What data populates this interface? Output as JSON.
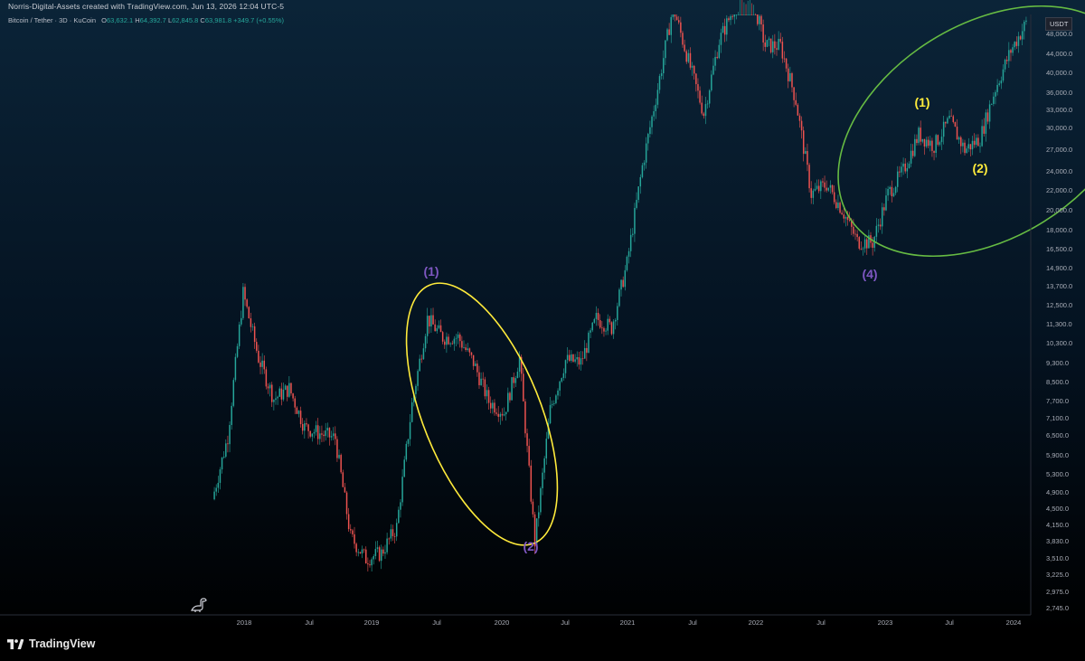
{
  "header": {
    "attribution": "Norris-Digital-Assets created with TradingView.com, Jun 13, 2026 12:04 UTC-5"
  },
  "legend": {
    "symbol": "Bitcoin / Tether · 3D · KuCoin",
    "open_label": "O",
    "open": "63,632.1",
    "high_label": "H",
    "high": "64,392.7",
    "low_label": "L",
    "low": "62,845.8",
    "close_label": "C",
    "close": "63,981.8",
    "change": "+349.7 (+0.55%)"
  },
  "price_axis": {
    "currency_badge": "USDT",
    "ticks": [
      "48,000.0",
      "44,000.0",
      "40,000.0",
      "36,000.0",
      "33,000.0",
      "30,000.0",
      "27,000.0",
      "24,000.0",
      "22,000.0",
      "20,000.0",
      "18,000.0",
      "16,500.0",
      "14,900.0",
      "13,700.0",
      "12,500.0",
      "11,300.0",
      "10,300.0",
      "9,300.0",
      "8,500.0",
      "7,700.0",
      "7,100.0",
      "6,500.0",
      "5,900.0",
      "5,300.0",
      "4,900.0",
      "4,500.0",
      "4,150.0",
      "3,830.0",
      "3,510.0",
      "3,225.0",
      "2,975.0",
      "2,745.0"
    ]
  },
  "time_axis": {
    "ticks": [
      "2018",
      "Jul",
      "2019",
      "Jul",
      "2020",
      "Jul",
      "2021",
      "Jul",
      "2022",
      "Jul",
      "2023",
      "Jul",
      "2024"
    ]
  },
  "annotations": {
    "wave_labels": [
      {
        "text": "(1)",
        "color": "#7e57c2"
      },
      {
        "text": "(2)",
        "color": "#7e57c2"
      },
      {
        "text": "(4)",
        "color": "#7e57c2"
      },
      {
        "text": "(1)",
        "color": "#ffeb3b"
      },
      {
        "text": "(2)",
        "color": "#ffeb3b"
      }
    ],
    "ellipse_colors": {
      "yellow": "#ffeb3b",
      "green": "#66bb43"
    }
  },
  "colors": {
    "up": "#26a69a",
    "down": "#ef5350",
    "bg_top": "#0b2438",
    "bg_bottom": "#000000"
  },
  "chart_data": {
    "type": "candlestick",
    "scale": "log",
    "ylim": [
      2745,
      50000
    ],
    "x": [
      "2017-10",
      "2017-12",
      "2018-01",
      "2018-02",
      "2018-04",
      "2018-05",
      "2018-07",
      "2018-08",
      "2018-10",
      "2018-11",
      "2018-12",
      "2019-02",
      "2019-04",
      "2019-05",
      "2019-06",
      "2019-07",
      "2019-08",
      "2019-09",
      "2019-11",
      "2019-12",
      "2020-02",
      "2020-03",
      "2020-04",
      "2020-05",
      "2020-07",
      "2020-08",
      "2020-10",
      "2020-11",
      "2020-12",
      "2021-01",
      "2021-03",
      "2021-05",
      "2021-07",
      "2021-08",
      "2021-10",
      "2021-11",
      "2022-01",
      "2022-03",
      "2022-05",
      "2022-06",
      "2022-08",
      "2022-09",
      "2022-11",
      "2022-12",
      "2023-02",
      "2023-03",
      "2023-04",
      "2023-06",
      "2023-07",
      "2023-08",
      "2023-10",
      "2023-11",
      "2024-01",
      "2024-02"
    ],
    "close": [
      4800,
      6500,
      13000,
      9500,
      7800,
      8200,
      6800,
      6600,
      6450,
      4000,
      3600,
      3700,
      4200,
      7600,
      11500,
      10500,
      10500,
      9300,
      7700,
      7300,
      9500,
      3900,
      7400,
      9400,
      9300,
      11500,
      11000,
      15000,
      24000,
      35000,
      52000,
      40000,
      31000,
      44000,
      52000,
      57000,
      43000,
      43000,
      33000,
      21000,
      22000,
      19500,
      16700,
      16600,
      21000,
      23500,
      28000,
      26500,
      30000,
      26000,
      27500,
      35000,
      42000,
      48000
    ],
    "units": "USDT"
  }
}
